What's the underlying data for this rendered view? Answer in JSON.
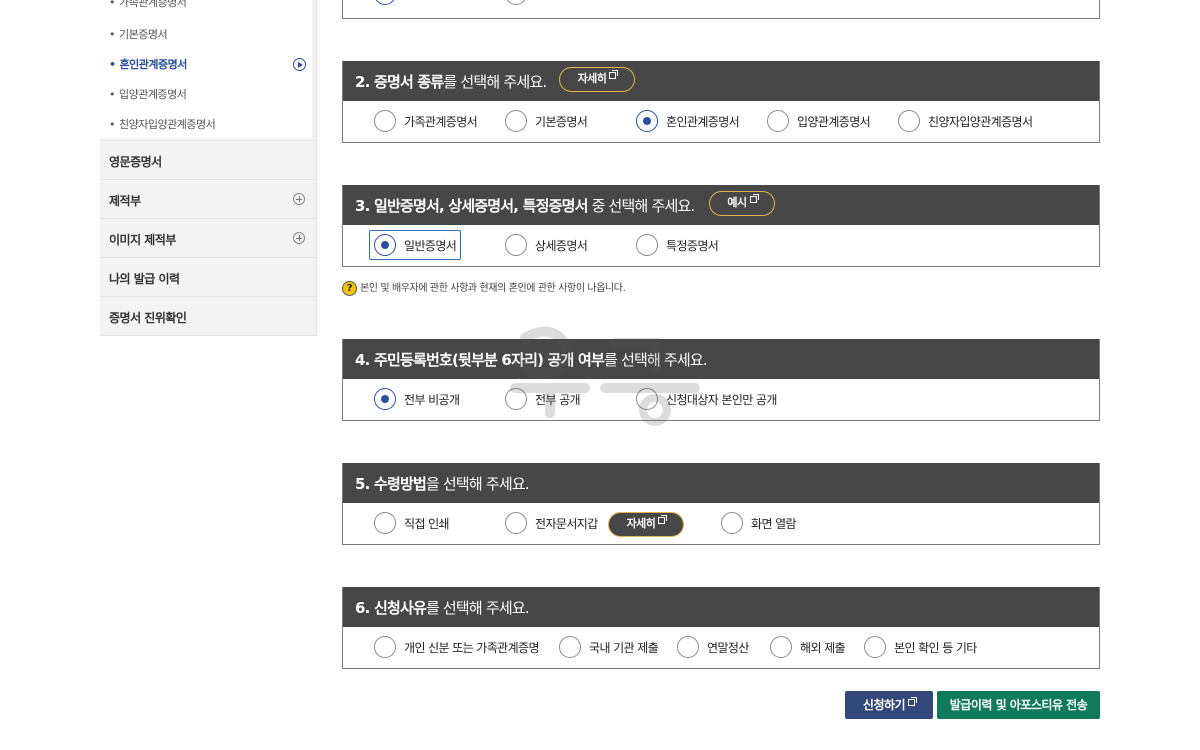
{
  "sidebar": {
    "sub_items": [
      {
        "label": "가족관계증명서"
      },
      {
        "label": "기본증명서"
      },
      {
        "label": "혼인관계증명서"
      },
      {
        "label": "입양관계증명서"
      },
      {
        "label": "친양자입양관계증명서"
      }
    ],
    "menu": [
      {
        "label": "영문증명서"
      },
      {
        "label": "제적부"
      },
      {
        "label": "이미지 제적부"
      },
      {
        "label": "나의 발급 이력"
      },
      {
        "label": "증명서 진위확인"
      }
    ]
  },
  "sections": {
    "s2": {
      "title_bold": "2. 증명서 종류",
      "title_rest": "를 선택해 주세요.",
      "button": "자세히",
      "options": [
        "가족관계증명서",
        "기본증명서",
        "혼인관계증명서",
        "입양관계증명서",
        "친양자입양관계증명서"
      ],
      "selected": "혼인관계증명서"
    },
    "s3": {
      "title_bold": "3. 일반증명서, 상세증명서, 특정증명서",
      "title_rest": " 중 선택해 주세요.",
      "button": "예시",
      "options": [
        "일반증명서",
        "상세증명서",
        "특정증명서"
      ],
      "selected": "일반증명서"
    },
    "notice": "본인 및 배우자에 관한 사항과 현재의 혼인에 관한 사항이 나옵니다.",
    "notice_icon": "?",
    "s4": {
      "title_bold": "4. 주민등록번호(뒷부분 6자리) 공개 여부",
      "title_rest": "를 선택해 주세요.",
      "options": [
        "전부 비공개",
        "전부 공개",
        "신청대상자 본인만 공개"
      ],
      "selected": "전부 비공개"
    },
    "s5": {
      "title_bold": "5. 수령방법",
      "title_rest": "을 선택해 주세요.",
      "options": [
        "직접 인쇄",
        "전자문서지갑",
        "화면 열람"
      ],
      "inline_button": "자세히",
      "selected": ""
    },
    "s6": {
      "title_bold": "6. 신청사유",
      "title_rest": "를 선택해 주세요.",
      "options": [
        "개인 신분 또는 가족관계증명",
        "국내 기관 제출",
        "연말정산",
        "해외 제출",
        "본인 확인 등 기타"
      ],
      "selected": ""
    }
  },
  "actions": {
    "apply": "신청하기",
    "send": "발급이력 및 아포스티유 전송"
  },
  "colors": {
    "header_bg": "#474747",
    "accent_blue": "#2a4fa0",
    "button_gold_border": "#e0b64c",
    "apply_bg": "#33487a",
    "send_bg": "#0f7a5c"
  }
}
